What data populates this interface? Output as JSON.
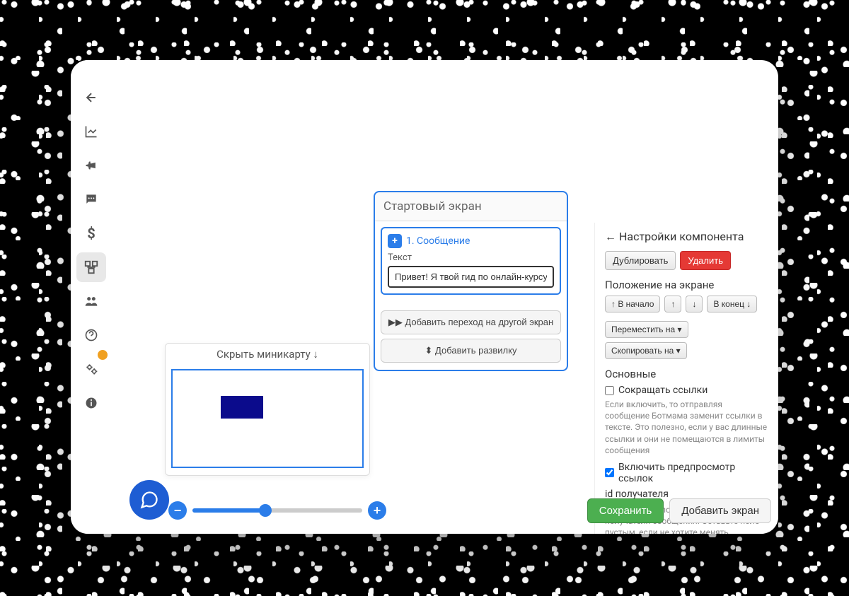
{
  "sidebar": {
    "items": [
      {
        "icon": "back-arrow-icon"
      },
      {
        "icon": "chart-icon"
      },
      {
        "icon": "megaphone-icon"
      },
      {
        "icon": "speech-icon"
      },
      {
        "icon": "dollar-icon"
      },
      {
        "icon": "flow-icon",
        "active": true
      },
      {
        "icon": "users-icon"
      },
      {
        "icon": "help-icon"
      },
      {
        "icon": "settings-icon",
        "has_dot": true
      },
      {
        "icon": "info-icon"
      }
    ]
  },
  "screen": {
    "title": "Стартовый экран",
    "component": {
      "badge": "+",
      "title": "1. Сообщение",
      "field_label": "Текст",
      "text_value": "Привет! Я твой гид по онлайн-курсу."
    },
    "actions": {
      "add_transition": "▶▶ Добавить переход на другой экран",
      "add_fork": "⬍ Добавить развилку"
    }
  },
  "settings": {
    "title": "← Настройки компонента",
    "duplicate": "Дублировать",
    "delete": "Удалить",
    "position_title": "Положение на экране",
    "to_start": "↑ В начало",
    "up": "↑",
    "down": "↓",
    "to_end": "В конец ↓",
    "move_to": "Переместить на ▾",
    "copy_to": "Скопировать на ▾",
    "main_title": "Основные",
    "shorten_links_label": "Сокращать ссылки",
    "shorten_links_checked": false,
    "shorten_links_desc": "Если включить, то отправляя сообщение Ботмама заменит ссылки в тексте. Это полезно, если у вас длинные ссылки и они не помещаются в лимиты сообщения",
    "preview_links_label": "Включить предпросмотр ссылок",
    "preview_links_checked": true,
    "recipient_id_title": "id получателя",
    "recipient_id_desc": "Это свойство позволяет сменить получателя сообщения. Оставьте поле пустым, если не хотите менять..."
  },
  "minimap": {
    "header": "Скрыть миникарту ↓"
  },
  "zoom": {
    "minus": "−",
    "plus": "+"
  },
  "bottom": {
    "save": "Сохранить",
    "add_screen": "Добавить экран"
  }
}
